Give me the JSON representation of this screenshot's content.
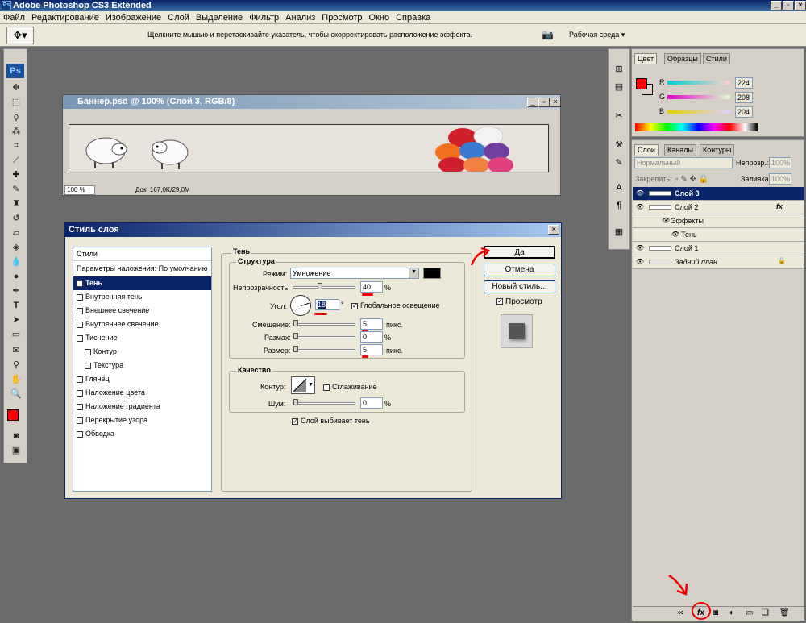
{
  "app": {
    "title": "Adobe Photoshop CS3 Extended",
    "ps_label": "Ps"
  },
  "menu": [
    "Файл",
    "Редактирование",
    "Изображение",
    "Слой",
    "Выделение",
    "Фильтр",
    "Анализ",
    "Просмотр",
    "Окно",
    "Справка"
  ],
  "options_bar": {
    "hint": "Щелкните мышью и перетаскивайте указатель, чтобы скорректировать расположение эффекта.",
    "workspace": "Рабочая среда ▾"
  },
  "document": {
    "title": "Баннер.psd @ 100% (Слой 3, RGB/8)",
    "zoom": "100 %",
    "doc_info": "Док: 167,0K/29,0M"
  },
  "dialog": {
    "title": "Стиль слоя",
    "styles_header": "Стили",
    "blend_options": "Параметры наложения: По умолчанию",
    "style_items": [
      {
        "label": "Тень",
        "checked": true
      },
      {
        "label": "Внутренняя тень",
        "checked": false
      },
      {
        "label": "Внешнее свечение",
        "checked": false
      },
      {
        "label": "Внутреннее свечение",
        "checked": false
      },
      {
        "label": "Тиснение",
        "checked": false
      },
      {
        "label": "Контур",
        "checked": false
      },
      {
        "label": "Текстура",
        "checked": false
      },
      {
        "label": "Глянец",
        "checked": false
      },
      {
        "label": "Наложение цвета",
        "checked": false
      },
      {
        "label": "Наложение градиента",
        "checked": false
      },
      {
        "label": "Перекрытие узора",
        "checked": false
      },
      {
        "label": "Обводка",
        "checked": false
      }
    ],
    "section_title": "Тень",
    "structure": {
      "title": "Структура",
      "mode_label": "Режим:",
      "mode_value": "Умножение",
      "mode_color": "#000000",
      "opacity_label": "Непрозрачность:",
      "opacity_value": "40",
      "opacity_unit": "%",
      "angle_label": "Угол:",
      "angle_value": "18",
      "angle_unit": "°",
      "global_light_label": "Глобальное освещение",
      "global_light": true,
      "offset_label": "Смещение:",
      "offset_value": "5",
      "offset_unit": "пикс.",
      "spread_label": "Размах:",
      "spread_value": "0",
      "spread_unit": "%",
      "size_label": "Размер:",
      "size_value": "5",
      "size_unit": "пикс."
    },
    "quality": {
      "title": "Качество",
      "contour_label": "Контур:",
      "antialias_label": "Сглаживание",
      "noise_label": "Шум:",
      "noise_value": "0",
      "noise_unit": "%"
    },
    "knockout_label": "Слой выбивает тень",
    "buttons": {
      "ok": "Да",
      "cancel": "Отмена",
      "new_style": "Новый стиль...",
      "preview": "Просмотр"
    }
  },
  "color_panel": {
    "tabs": [
      "Цвет",
      "Образцы",
      "Стили"
    ],
    "r_label": "R",
    "r": "224",
    "g_label": "G",
    "g": "208",
    "b_label": "B",
    "b": "204",
    "foreground": "#ff0000"
  },
  "layers_panel": {
    "tabs": [
      "Слои",
      "Каналы",
      "Контуры"
    ],
    "blend_mode": "Нормальный",
    "opacity_label": "Непрозр.:",
    "opacity": "100%",
    "lock_label": "Закрепить:",
    "fill_label": "Заливка:",
    "fill": "100%",
    "layers": [
      {
        "name": "Слой 3",
        "selected": true
      },
      {
        "name": "Слой 2",
        "selected": false,
        "fx": "fx"
      },
      {
        "name": "Эффекты",
        "sub": true
      },
      {
        "name": "Тень",
        "sub2": true
      },
      {
        "name": "Слой 1",
        "selected": false
      },
      {
        "name": "Задний план",
        "selected": false,
        "italic": true
      }
    ],
    "fx_button": "fx"
  }
}
